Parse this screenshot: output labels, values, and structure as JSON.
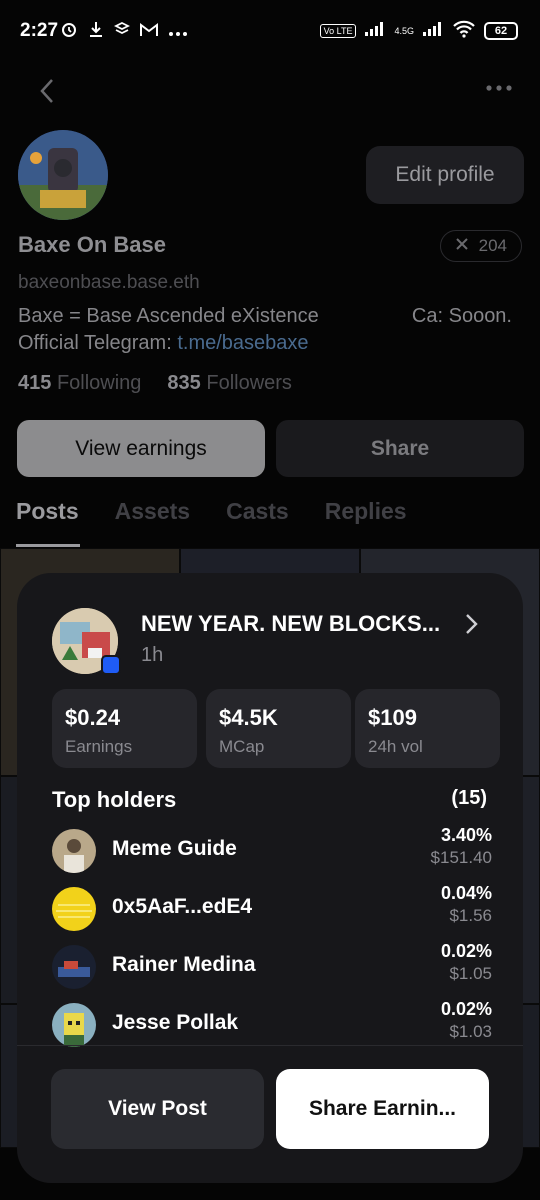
{
  "status_bar": {
    "time": "2:27",
    "network_label": "4.5G",
    "volte_label": "Vo LTE",
    "battery": "62"
  },
  "profile": {
    "name": "Baxe On Base",
    "handle": "baxeonbase.base.eth",
    "edit_label": "Edit profile",
    "x_count": "204",
    "bio_line1": "Baxe =  Base Ascended eXistence",
    "bio_ca": "Ca: Sooon.",
    "bio_line2_prefix": "Official Telegram: ",
    "bio_link": "t.me/basebaxe",
    "following_count": "415",
    "following_label": "Following",
    "followers_count": "835",
    "followers_label": "Followers",
    "view_earnings_label": "View earnings",
    "share_label": "Share"
  },
  "tabs": [
    {
      "label": "Posts",
      "active": true
    },
    {
      "label": "Assets",
      "active": false
    },
    {
      "label": "Casts",
      "active": false
    },
    {
      "label": "Replies",
      "active": false
    }
  ],
  "sheet": {
    "post_title": "NEW YEAR. NEW BLOCKS...",
    "post_time": "1h",
    "stats": [
      {
        "value": "$0.24",
        "label": "Earnings"
      },
      {
        "value": "$4.5K",
        "label": "MCap"
      },
      {
        "value": "$109",
        "label": "24h vol"
      }
    ],
    "holders_title": "Top holders",
    "holders_count": "(15)",
    "holders": [
      {
        "name": "Meme Guide",
        "pct": "3.40%",
        "usd": "$151.40"
      },
      {
        "name": "0x5AaF...edE4",
        "pct": "0.04%",
        "usd": "$1.56"
      },
      {
        "name": "Rainer Medina",
        "pct": "0.02%",
        "usd": "$1.05"
      },
      {
        "name": "Jesse Pollak",
        "pct": "0.02%",
        "usd": "$1.03"
      }
    ],
    "view_post_label": "View Post",
    "share_earnings_label": "Share Earnin..."
  },
  "colors": {
    "accent_blue": "#1f5cf5",
    "link": "#4a6b8f",
    "sheet_bg": "#17171a"
  }
}
